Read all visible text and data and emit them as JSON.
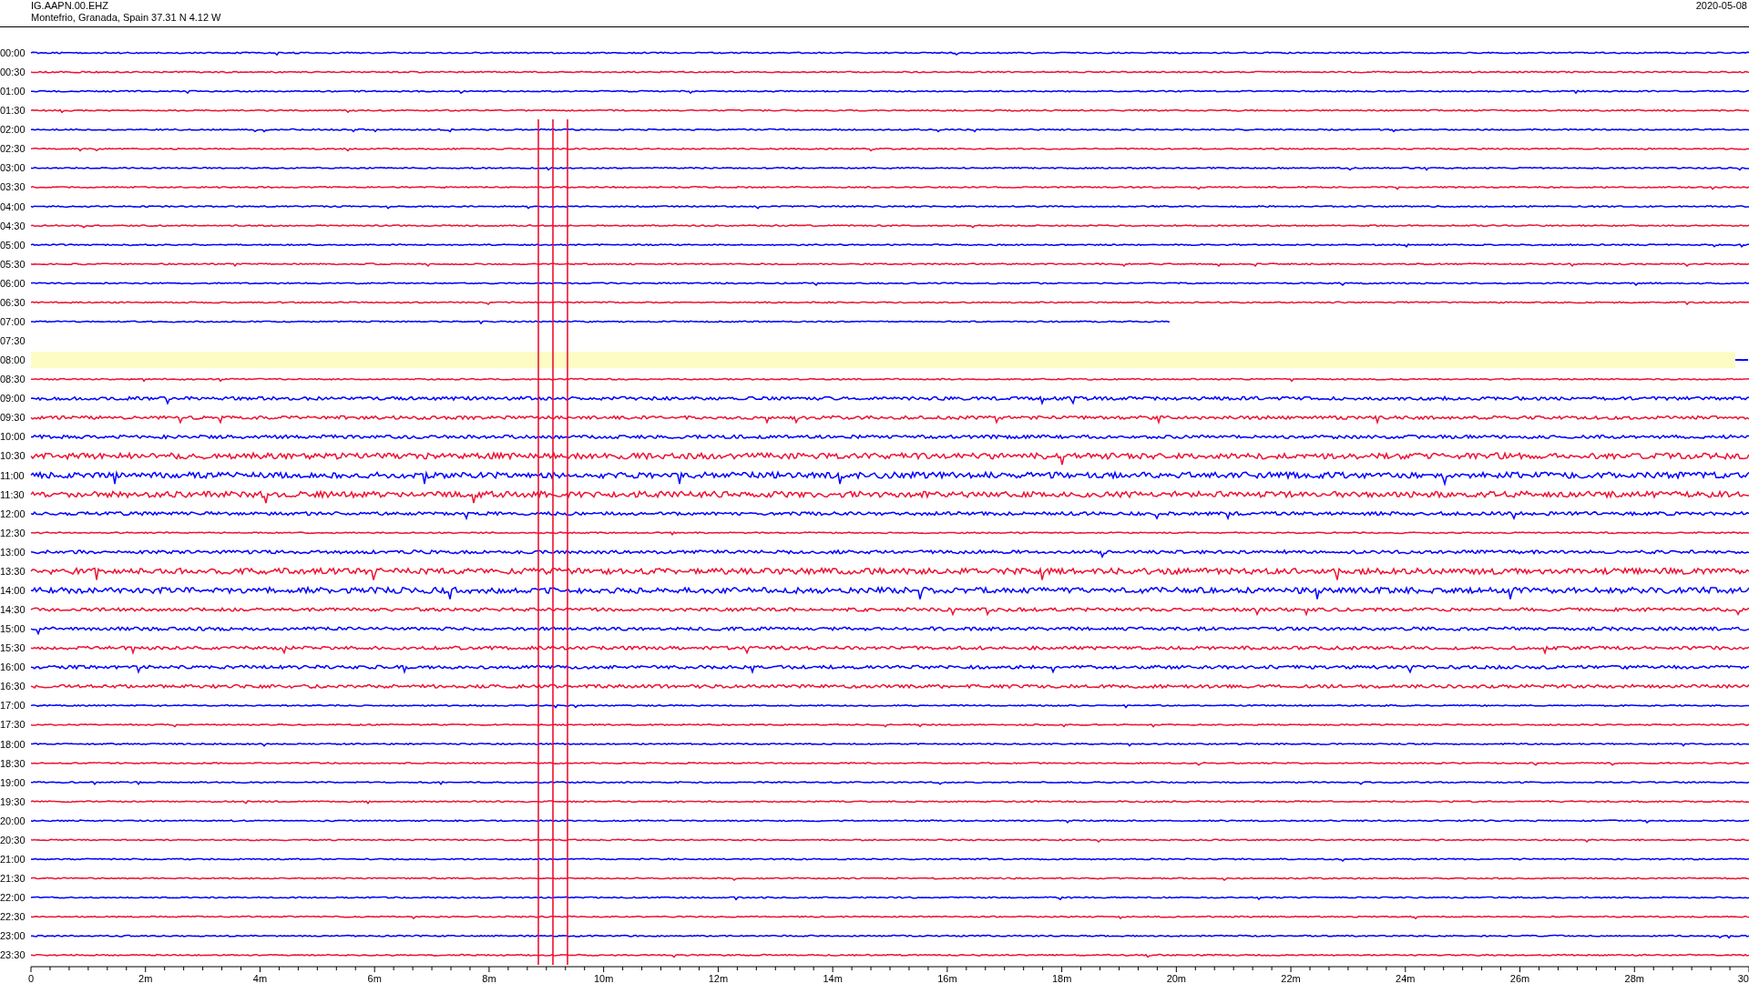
{
  "header": {
    "station": "IG.AAPN.00.EHZ",
    "location": "Montefrio, Granada, Spain  37.31 N 4.12 W",
    "date": "2020-05-08"
  },
  "rows": [
    {
      "time": "00:00",
      "color": "#0000ff",
      "kind": "quiet"
    },
    {
      "time": "00:30",
      "color": "#ee1133",
      "kind": "quiet"
    },
    {
      "time": "01:00",
      "color": "#0000ff",
      "kind": "quiet"
    },
    {
      "time": "01:30",
      "color": "#ee1133",
      "kind": "quiet"
    },
    {
      "time": "02:00",
      "color": "#0000ff",
      "kind": "quiet"
    },
    {
      "time": "02:30",
      "color": "#ee1133",
      "kind": "quiet"
    },
    {
      "time": "03:00",
      "color": "#0000ff",
      "kind": "quiet"
    },
    {
      "time": "03:30",
      "color": "#ee1133",
      "kind": "quiet"
    },
    {
      "time": "04:00",
      "color": "#0000ff",
      "kind": "quiet"
    },
    {
      "time": "04:30",
      "color": "#ee1133",
      "kind": "quiet"
    },
    {
      "time": "05:00",
      "color": "#0000ff",
      "kind": "quiet"
    },
    {
      "time": "05:30",
      "color": "#ee1133",
      "kind": "quiet"
    },
    {
      "time": "06:00",
      "color": "#0000ff",
      "kind": "quiet"
    },
    {
      "time": "06:30",
      "color": "#ee1133",
      "kind": "quiet"
    },
    {
      "time": "07:00",
      "color": "#0000ff",
      "kind": "partial"
    },
    {
      "time": "07:30",
      "kind": "empty"
    },
    {
      "time": "08:00",
      "color": "#0000ff",
      "kind": "highlight"
    },
    {
      "time": "08:30",
      "color": "#ee1133",
      "kind": "quiet"
    },
    {
      "time": "09:00",
      "color": "#0000ff",
      "kind": "medium"
    },
    {
      "time": "09:30",
      "color": "#ee1133",
      "kind": "medium"
    },
    {
      "time": "10:00",
      "color": "#0000ff",
      "kind": "medium"
    },
    {
      "time": "10:30",
      "color": "#ee1133",
      "kind": "noisy"
    },
    {
      "time": "11:00",
      "color": "#0000ff",
      "kind": "noisy"
    },
    {
      "time": "11:30",
      "color": "#ee1133",
      "kind": "noisy"
    },
    {
      "time": "12:00",
      "color": "#0000ff",
      "kind": "medium"
    },
    {
      "time": "12:30",
      "color": "#ee1133",
      "kind": "quiet"
    },
    {
      "time": "13:00",
      "color": "#0000ff",
      "kind": "medium"
    },
    {
      "time": "13:30",
      "color": "#ee1133",
      "kind": "noisy"
    },
    {
      "time": "14:00",
      "color": "#0000ff",
      "kind": "noisy"
    },
    {
      "time": "14:30",
      "color": "#ee1133",
      "kind": "medium"
    },
    {
      "time": "15:00",
      "color": "#0000ff",
      "kind": "medium"
    },
    {
      "time": "15:30",
      "color": "#ee1133",
      "kind": "medium"
    },
    {
      "time": "16:00",
      "color": "#0000ff",
      "kind": "medium"
    },
    {
      "time": "16:30",
      "color": "#ee1133",
      "kind": "medium"
    },
    {
      "time": "17:00",
      "color": "#0000ff",
      "kind": "quiet"
    },
    {
      "time": "17:30",
      "color": "#ee1133",
      "kind": "quiet"
    },
    {
      "time": "18:00",
      "color": "#0000ff",
      "kind": "quiet"
    },
    {
      "time": "18:30",
      "color": "#ee1133",
      "kind": "quiet"
    },
    {
      "time": "19:00",
      "color": "#0000ff",
      "kind": "quiet"
    },
    {
      "time": "19:30",
      "color": "#ee1133",
      "kind": "quiet"
    },
    {
      "time": "20:00",
      "color": "#0000ff",
      "kind": "quiet"
    },
    {
      "time": "20:30",
      "color": "#ee1133",
      "kind": "quiet"
    },
    {
      "time": "21:00",
      "color": "#0000ff",
      "kind": "quiet"
    },
    {
      "time": "21:30",
      "color": "#ee1133",
      "kind": "quiet"
    },
    {
      "time": "22:00",
      "color": "#0000ff",
      "kind": "quiet"
    },
    {
      "time": "22:30",
      "color": "#ee1133",
      "kind": "quiet"
    },
    {
      "time": "23:00",
      "color": "#0000ff",
      "kind": "quiet"
    },
    {
      "time": "23:30",
      "color": "#ee1133",
      "kind": "quiet"
    }
  ],
  "x_axis_labels": [
    "0",
    "2m",
    "4m",
    "6m",
    "8m",
    "10m",
    "12m",
    "14m",
    "16m",
    "18m",
    "20m",
    "22m",
    "24m",
    "26m",
    "28m",
    "30"
  ]
}
